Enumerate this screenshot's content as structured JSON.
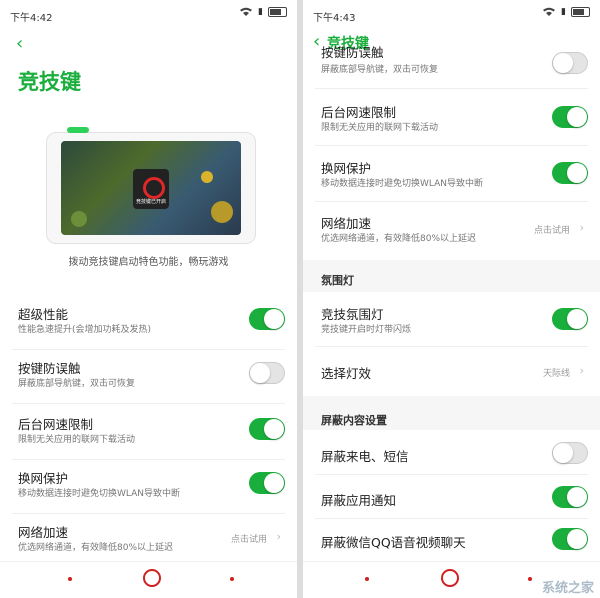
{
  "left": {
    "status": {
      "time": "下午4:42"
    },
    "title": "竞技键",
    "hero_caption": "拨动竞技键启动特色功能，畅玩游戏",
    "screen_caption": "竞技键已开启",
    "rows": [
      {
        "label": "超级性能",
        "sub": "性能急速提升(会增加功耗及发热)",
        "toggle": true
      },
      {
        "label": "按键防误触",
        "sub": "屏蔽底部导航键，双击可恢复",
        "toggle": false
      },
      {
        "label": "后台网速限制",
        "sub": "限制无关应用的联网下载活动",
        "toggle": true
      },
      {
        "label": "换网保护",
        "sub": "移动数据连接时避免切换WLAN导致中断",
        "toggle": true
      },
      {
        "label": "网络加速",
        "sub": "优选网络通道，有效降低80%以上延迟",
        "value": "点击试用"
      }
    ]
  },
  "right": {
    "status": {
      "time": "下午4:43"
    },
    "header_title": "竞技键",
    "rows_top": [
      {
        "label": "按键防误触",
        "sub": "屏蔽底部导航键，双击可恢复",
        "toggle": false
      },
      {
        "label": "后台网速限制",
        "sub": "限制无关应用的联网下载活动",
        "toggle": true
      },
      {
        "label": "换网保护",
        "sub": "移动数据连接时避免切换WLAN导致中断",
        "toggle": true
      },
      {
        "label": "网络加速",
        "sub": "优选网络通道，有效降低80%以上延迟",
        "value": "点击试用"
      }
    ],
    "section_ambient": "氛围灯",
    "ambient_rows": [
      {
        "label": "竞技氛围灯",
        "sub": "竞技键开启时灯带闪烁",
        "toggle": true
      },
      {
        "label": "选择灯效",
        "value": "天际线"
      }
    ],
    "section_block": "屏蔽内容设置",
    "block_rows": [
      {
        "label": "屏蔽来电、短信",
        "toggle": false
      },
      {
        "label": "屏蔽应用通知",
        "toggle": true
      },
      {
        "label": "屏蔽微信QQ语音视频聊天",
        "toggle": true
      }
    ]
  },
  "icons": {
    "back": "chevron-left-icon",
    "wifi": "wifi-icon",
    "signal": "signal-icon",
    "battery": "battery-icon",
    "chevron": "chevron-right-icon",
    "home": "home-circle-icon"
  },
  "symbols": {
    "back": "‹",
    "chev": "›",
    "signal": "▮"
  },
  "colors": {
    "accent": "#1aae3c",
    "nav": "#d02020"
  },
  "watermark": "系统之家"
}
